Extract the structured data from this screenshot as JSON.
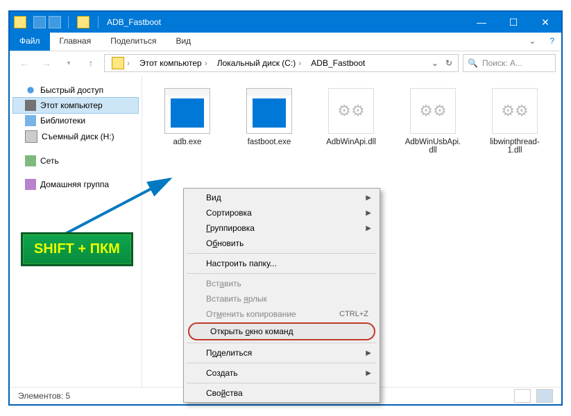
{
  "window": {
    "title": "ADB_Fastboot"
  },
  "ribbon": {
    "file": "Файл",
    "tabs": [
      "Главная",
      "Поделиться",
      "Вид"
    ]
  },
  "breadcrumbs": [
    "Этот компьютер",
    "Локальный диск (C:)",
    "ADB_Fastboot"
  ],
  "search": {
    "placeholder": "Поиск: A..."
  },
  "sidebar": {
    "quick_access": "Быстрый доступ",
    "this_pc": "Этот компьютер",
    "libraries": "Библиотеки",
    "removable": "Съемный диск (H:)",
    "network": "Сеть",
    "homegroup": "Домашняя группа"
  },
  "files": [
    {
      "name": "adb.exe",
      "type": "exe"
    },
    {
      "name": "fastboot.exe",
      "type": "exe"
    },
    {
      "name": "AdbWinApi.dll",
      "type": "dll"
    },
    {
      "name": "AdbWinUsbApi.dll",
      "type": "dll"
    },
    {
      "name": "libwinpthread-1.dll",
      "type": "dll"
    }
  ],
  "context_menu": {
    "view": "Вид",
    "sort": "Сортировка",
    "group": "Группировка",
    "refresh": "Обновить",
    "customize": "Настроить папку...",
    "paste": "Вставить",
    "paste_shortcut": "Вставить ярлык",
    "undo_copy": "Отменить копирование",
    "undo_shortcut": "CTRL+Z",
    "open_cmd": "Открыть окно команд",
    "share": "Поделиться",
    "new": "Создать",
    "properties": "Свойства"
  },
  "status": {
    "items": "Элементов: 5"
  },
  "hint": "SHIFT + ПКМ"
}
